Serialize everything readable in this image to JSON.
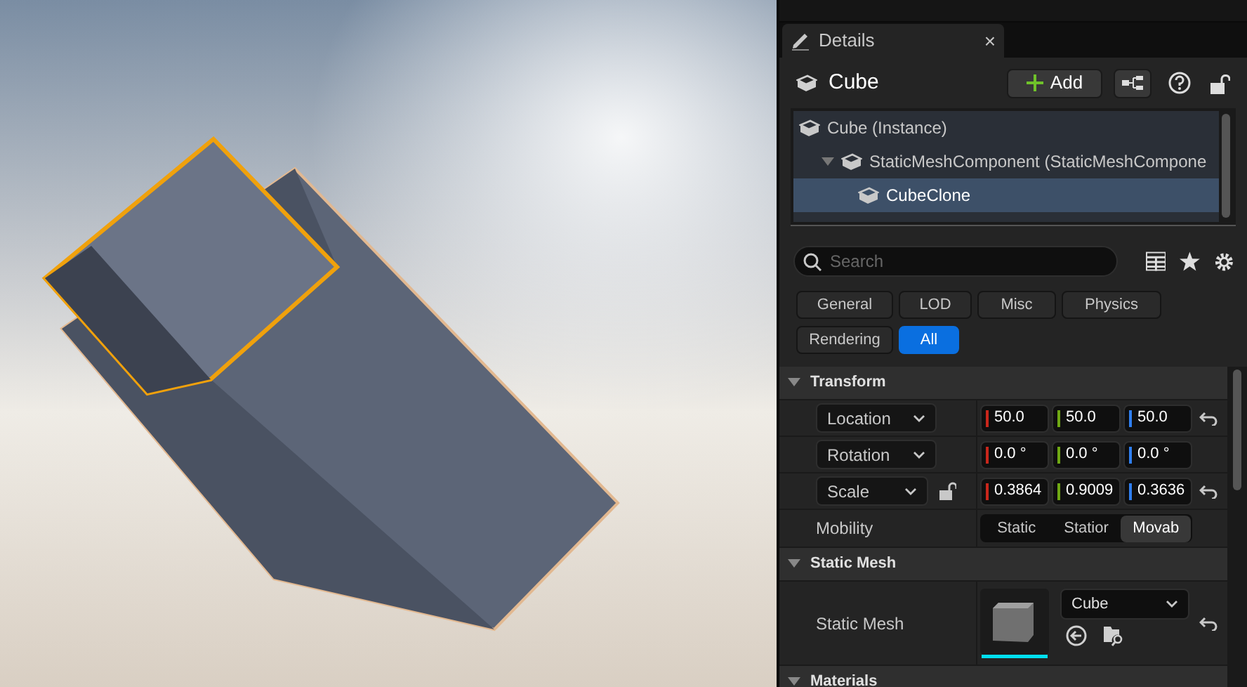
{
  "details_tab": {
    "title": "Details",
    "close": "×"
  },
  "actor": {
    "name": "Cube",
    "add_button": "Add"
  },
  "components": [
    {
      "label": "Cube (Instance)",
      "selected": false,
      "children": [
        {
          "label": "StaticMeshComponent (StaticMeshCompone",
          "selected": false,
          "expanded": true,
          "children": [
            {
              "label": "CubeClone",
              "selected": true
            }
          ]
        }
      ]
    }
  ],
  "search": {
    "placeholder": "Search"
  },
  "filters": [
    {
      "label": "General",
      "selected": false
    },
    {
      "label": "LOD",
      "selected": false
    },
    {
      "label": "Misc",
      "selected": false
    },
    {
      "label": "Physics",
      "selected": false
    },
    {
      "label": "Rendering",
      "selected": false
    },
    {
      "label": "All",
      "selected": true
    }
  ],
  "sections": [
    {
      "title": "Transform",
      "expanded": true,
      "rows": [
        {
          "kind": "vector",
          "label": "Location",
          "values": [
            "50.0",
            "50.0",
            "50.0"
          ],
          "reset": true
        },
        {
          "kind": "vector",
          "label": "Rotation",
          "values": [
            "0.0 °",
            "0.0 °",
            "0.0 °"
          ],
          "reset": false
        },
        {
          "kind": "vector",
          "label": "Scale",
          "values": [
            "0.3864",
            "0.9009",
            "0.3636"
          ],
          "locked": false,
          "reset": true
        },
        {
          "kind": "choice",
          "label": "Mobility",
          "options": [
            {
              "label": "Static",
              "selected": false
            },
            {
              "label": "Statior",
              "selected": false
            },
            {
              "label": "Movab",
              "selected": true
            }
          ]
        }
      ]
    },
    {
      "title": "Static Mesh",
      "expanded": true,
      "rows": [
        {
          "kind": "asset",
          "label": "Static Mesh",
          "value": "Cube",
          "reset": true
        }
      ]
    },
    {
      "title": "Materials",
      "expanded": true
    }
  ]
}
